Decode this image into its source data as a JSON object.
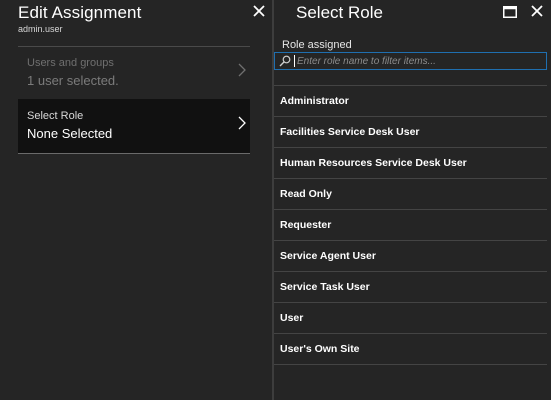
{
  "left_blade": {
    "title": "Edit Assignment",
    "subtitle": "admin.user",
    "items": [
      {
        "label": "Users and groups",
        "value": "1 user selected."
      },
      {
        "label": "Select Role",
        "value": "None Selected"
      }
    ]
  },
  "right_blade": {
    "title": "Select Role",
    "role_label": "Role assigned",
    "filter": {
      "placeholder": "Enter role name to filter items...",
      "value": ""
    },
    "roles": [
      "Administrator",
      "Facilities Service Desk User",
      "Human Resources Service Desk User",
      "Read Only",
      "Requester",
      "Service Agent User",
      "Service Task User",
      "User",
      "User's Own Site"
    ]
  },
  "colors": {
    "background": "#252525",
    "active_item": "#111111",
    "filter_border": "#1f6fb0",
    "divider": "#444444"
  },
  "icons": [
    "close-icon",
    "chevron-right-icon",
    "maximize-icon",
    "search-icon"
  ]
}
